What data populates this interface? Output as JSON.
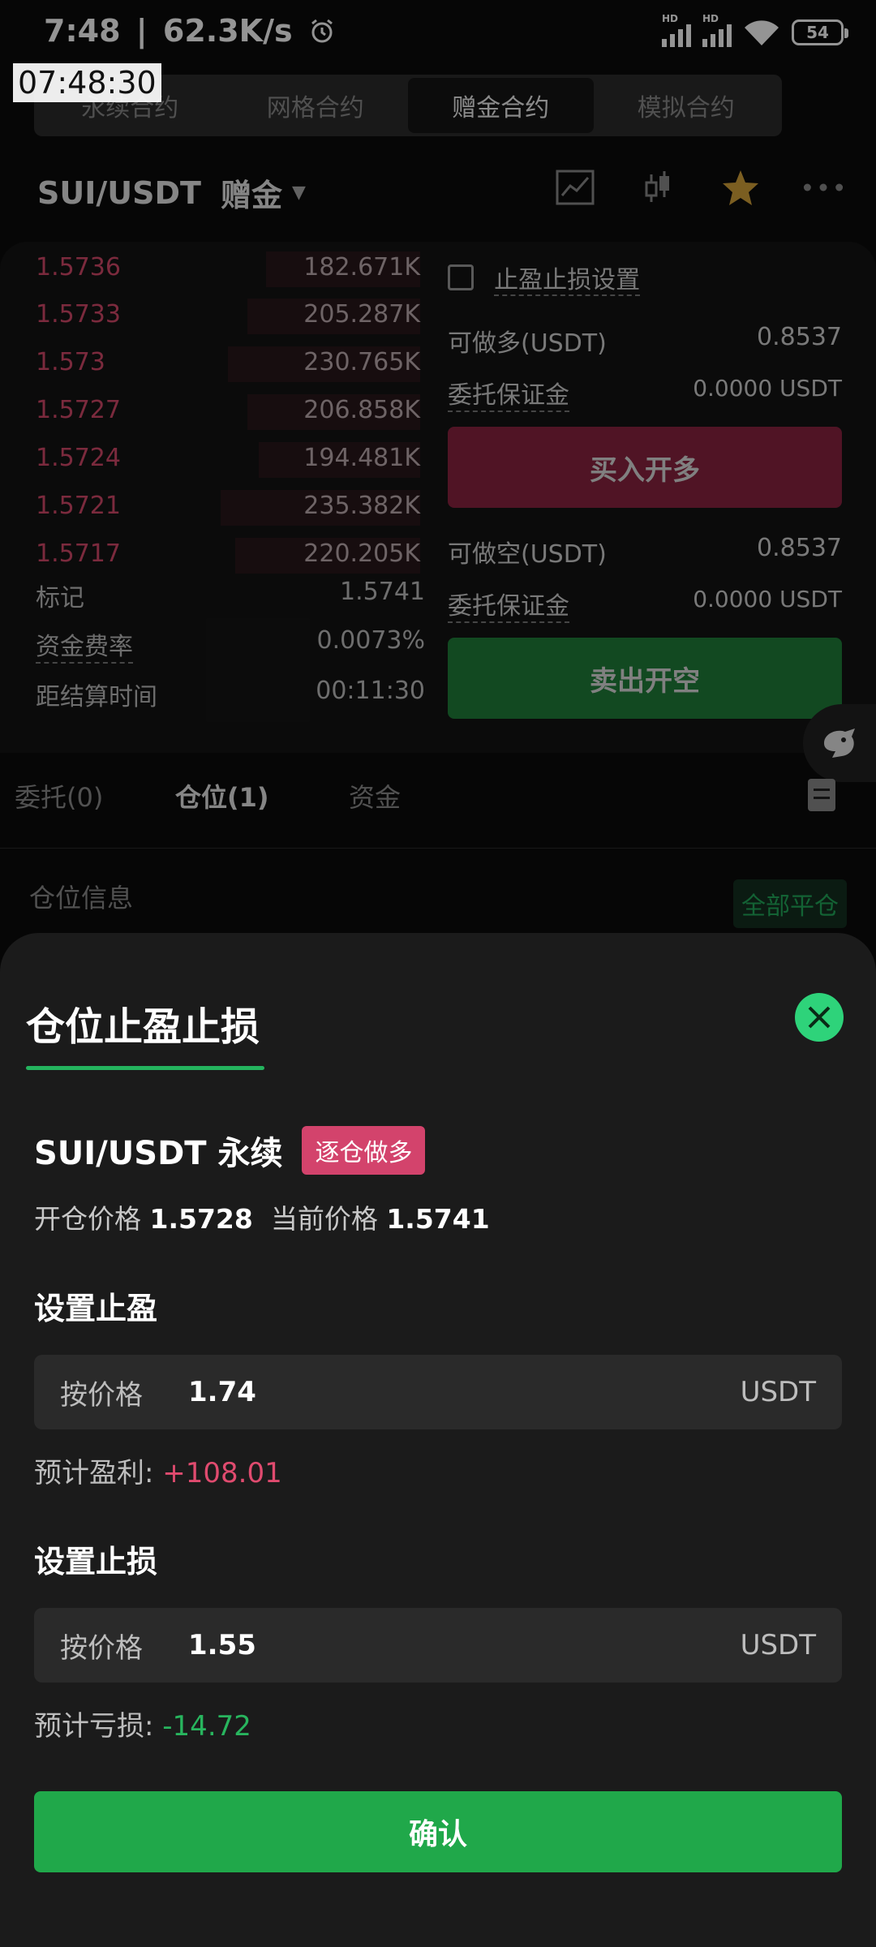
{
  "status_bar": {
    "time": "7:48",
    "speed": "62.3K/s",
    "battery": "54",
    "sig_hd": "HD"
  },
  "clock_overlay": "07:48:30",
  "top_tabs": [
    {
      "label": "永续合约",
      "active": false
    },
    {
      "label": "网格合约",
      "active": false
    },
    {
      "label": "赠金合约",
      "active": true
    },
    {
      "label": "模拟合约",
      "active": false
    }
  ],
  "header": {
    "pair": "SUI/USDT",
    "mode": "赠金"
  },
  "order_book": [
    {
      "price": "1.5736",
      "qty": "182.671K"
    },
    {
      "price": "1.5733",
      "qty": "205.287K"
    },
    {
      "price": "1.573",
      "qty": "230.765K"
    },
    {
      "price": "1.5727",
      "qty": "206.858K"
    },
    {
      "price": "1.5724",
      "qty": "194.481K"
    },
    {
      "price": "1.5721",
      "qty": "235.382K"
    },
    {
      "price": "1.5717",
      "qty": "220.205K"
    }
  ],
  "market_info": {
    "mark_label": "标记",
    "mark_value": "1.5741",
    "funding_label": "资金费率",
    "funding_value": "0.0073%",
    "settle_label": "距结算时间",
    "settle_value": "00:11:30"
  },
  "order_panel": {
    "tpsl_setting": "止盈止损设置",
    "long_avail_label": "可做多(USDT)",
    "long_avail_value": "0.8537",
    "margin_label": "委托保证金",
    "long_margin_value": "0.0000 USDT",
    "buy_button": "买入开多",
    "short_avail_label": "可做空(USDT)",
    "short_avail_value": "0.8537",
    "short_margin_value": "0.0000 USDT",
    "sell_button": "卖出开空"
  },
  "position_tabs": [
    {
      "label": "委托(0)",
      "active": false
    },
    {
      "label": "仓位(1)",
      "active": true
    },
    {
      "label": "资金",
      "active": false
    }
  ],
  "position": {
    "info_label": "仓位信息",
    "close_all": "全部平仓"
  },
  "sheet": {
    "title": "仓位止盈止损",
    "symbol": "SUI/USDT 永续",
    "badge": "逐仓做多",
    "open_price_label": "开仓价格",
    "open_price": "1.5728",
    "current_price_label": "当前价格",
    "current_price": "1.5741",
    "tp_title": "设置止盈",
    "tp_mode": "按价格",
    "tp_value": "1.74",
    "tp_unit": "USDT",
    "tp_est_label": "预计盈利:",
    "tp_est_value": "+108.01",
    "sl_title": "设置止损",
    "sl_mode": "按价格",
    "sl_value": "1.55",
    "sl_unit": "USDT",
    "sl_est_label": "预计亏损:",
    "sl_est_value": "-14.72",
    "confirm": "确认"
  },
  "colors": {
    "accent_green": "#20a84a",
    "profit_red": "#e04b6f",
    "badge_red": "#d3436c",
    "star_gold": "#d4a23a"
  },
  "icons": [
    "alarm-icon",
    "signal-icon",
    "wifi-icon",
    "battery-icon",
    "chart-line-icon",
    "candlestick-icon",
    "star-icon",
    "more-icon",
    "robot-icon",
    "document-icon",
    "close-icon",
    "caret-down-icon"
  ]
}
